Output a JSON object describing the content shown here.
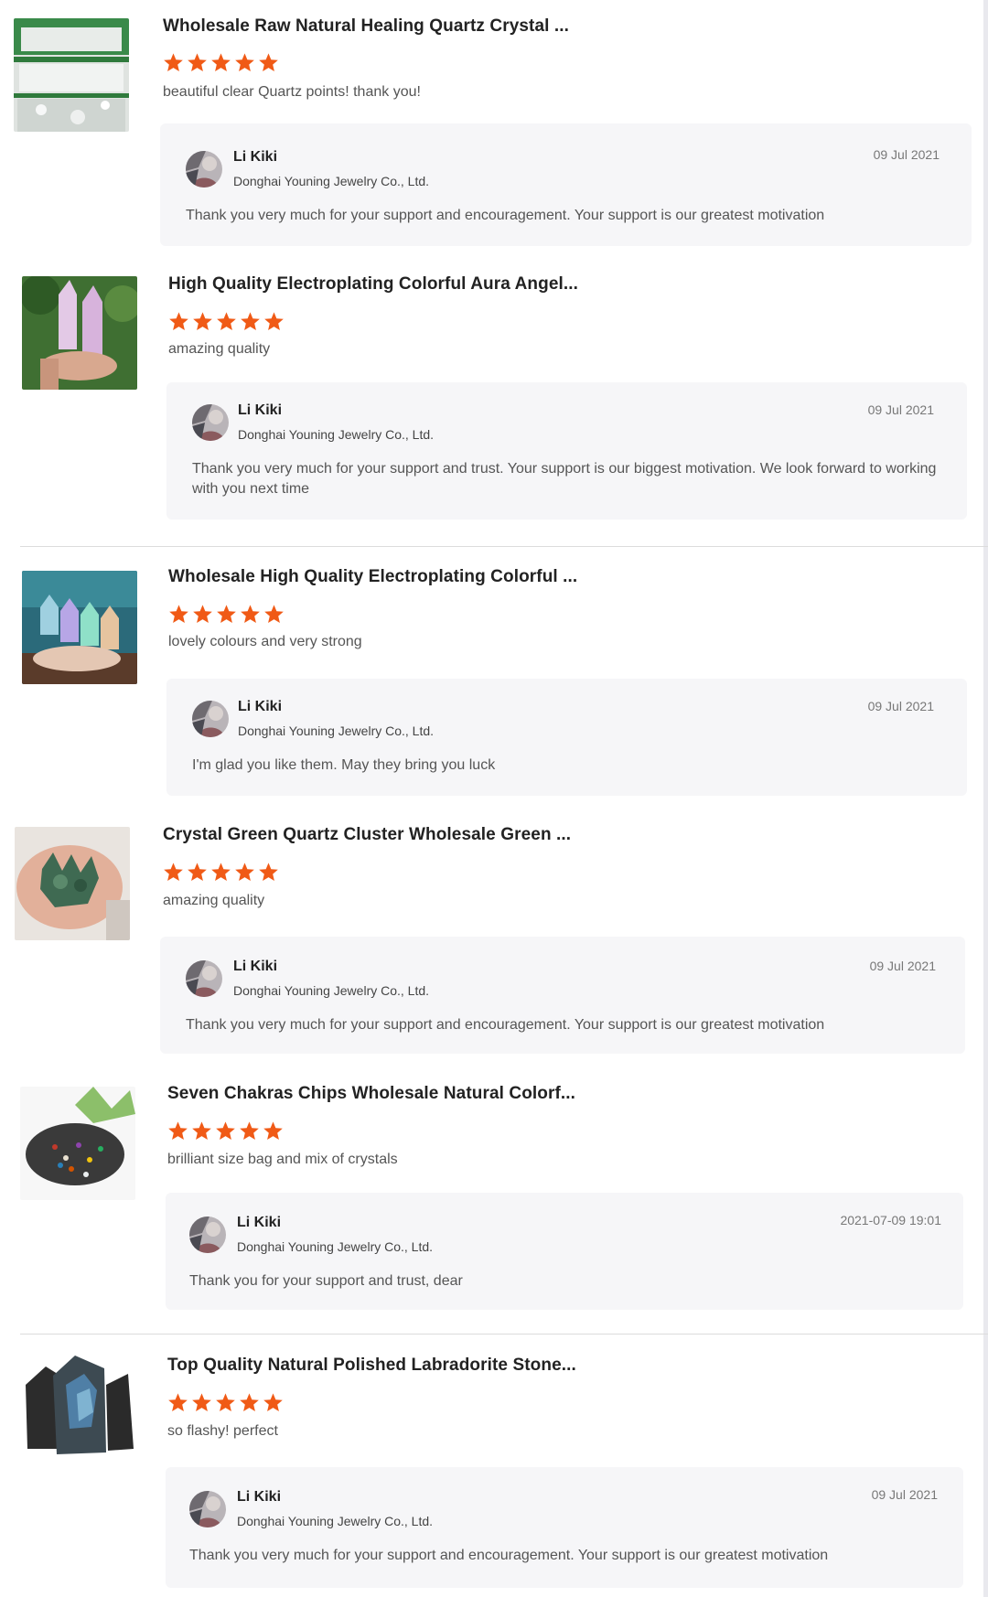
{
  "colors": {
    "star": "#f05a16",
    "reply_bg": "#f6f6f8",
    "divider": "#dcdcdc"
  },
  "icons": {
    "rating_star": "star-icon"
  },
  "reviews": [
    {
      "product_title": "Wholesale Raw Natural Healing Quartz Crystal ...",
      "rating": 5,
      "comment": "beautiful clear Quartz points! thank you!",
      "reply": {
        "name": "Li Kiki",
        "company": "Donghai Youning Jewelry Co., Ltd.",
        "date": "09 Jul 2021",
        "text": "Thank you very much for your support and encouragement. Your support is our greatest motivation"
      }
    },
    {
      "product_title": "High Quality Electroplating Colorful Aura Angel...",
      "rating": 5,
      "comment": "amazing quality",
      "reply": {
        "name": "Li Kiki",
        "company": "Donghai Youning Jewelry Co., Ltd.",
        "date": "09 Jul 2021",
        "text": "Thank you very much for your support and trust. Your support is our biggest motivation. We look forward to working with you next time"
      }
    },
    {
      "product_title": "Wholesale High Quality Electroplating Colorful ...",
      "rating": 5,
      "comment": "lovely colours and very strong",
      "reply": {
        "name": "Li Kiki",
        "company": "Donghai Youning Jewelry Co., Ltd.",
        "date": "09 Jul 2021",
        "text": "I'm glad you like them. May they bring you luck"
      }
    },
    {
      "product_title": "Crystal Green Quartz Cluster Wholesale Green ...",
      "rating": 5,
      "comment": "amazing quality",
      "reply": {
        "name": "Li Kiki",
        "company": "Donghai Youning Jewelry Co., Ltd.",
        "date": "09 Jul 2021",
        "text": "Thank you very much for your support and encouragement. Your support is our greatest motivation"
      }
    },
    {
      "product_title": "Seven Chakras Chips Wholesale Natural Colorf...",
      "rating": 5,
      "comment": "brilliant size bag and mix of crystals",
      "reply": {
        "name": "Li Kiki",
        "company": "Donghai Youning Jewelry Co., Ltd.",
        "date": "2021-07-09 19:01",
        "text": "Thank you for your support and trust, dear"
      }
    },
    {
      "product_title": "Top Quality Natural Polished Labradorite Stone...",
      "rating": 5,
      "comment": "so flashy! perfect",
      "reply": {
        "name": "Li Kiki",
        "company": "Donghai Youning Jewelry Co., Ltd.",
        "date": "09 Jul 2021",
        "text": "Thank you very much for your support and encouragement. Your support is our greatest motivation"
      }
    }
  ]
}
